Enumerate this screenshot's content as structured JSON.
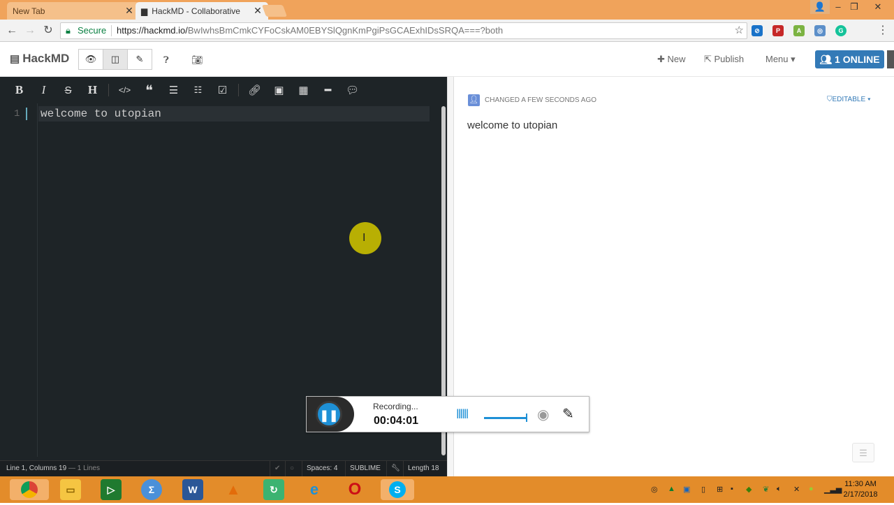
{
  "browser": {
    "tabs": [
      {
        "title": "New Tab",
        "close": "✕"
      },
      {
        "title": "HackMD - Collaborative",
        "close": "✕"
      }
    ],
    "secure_label": "Secure",
    "url_host": "https://hackmd.io/",
    "url_path": "BwIwhsBmCmkCYFoCskAM0EBYSlQgnKmPgiPsGCAExhIDsSRQA===?both"
  },
  "hackmd": {
    "brand": "HackMD",
    "new_label": "New",
    "publish_label": "Publish",
    "menu_label": "Menu",
    "online_label": "1 ONLINE"
  },
  "editor": {
    "line_number": "1",
    "content": "welcome to utopian",
    "status_left": "Line 1, Columns 19",
    "status_lines": "— 1 Lines",
    "spaces": "Spaces: 4",
    "keymap": "SUBLIME",
    "length": "Length 18"
  },
  "preview": {
    "changed": "CHANGED A FEW SECONDS AGO",
    "editable": "EDITABLE",
    "content": "welcome to utopian"
  },
  "recorder": {
    "status": "Recording...",
    "time": "00:04:01"
  },
  "taskbar": {
    "time": "11:30 AM",
    "date": "2/17/2018"
  },
  "colors": {
    "tabbar": "#f0a35b",
    "editor_bg": "#1e2427",
    "online_btn": "#337ab7",
    "taskbar": "#e38c2a",
    "recorder_accent": "#1e90d6"
  }
}
